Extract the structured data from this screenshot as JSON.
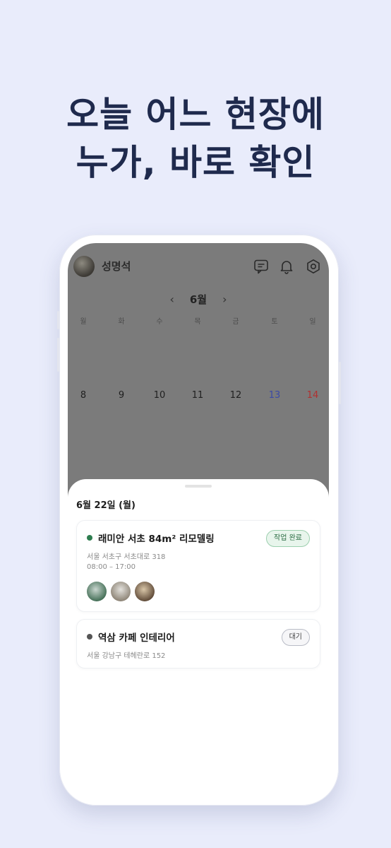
{
  "headline": {
    "line1": "오늘 어느 현장에",
    "line2": "누가, 바로 확인"
  },
  "header": {
    "user_name": "성명석",
    "icons": [
      "chat-icon",
      "bell-icon",
      "settings-icon"
    ]
  },
  "calendar": {
    "month": "6월",
    "prev": "‹",
    "next": "›",
    "weekdays": [
      "월",
      "화",
      "수",
      "목",
      "금",
      "토",
      "일"
    ],
    "dates": [
      "8",
      "9",
      "10",
      "11",
      "12",
      "13",
      "14"
    ]
  },
  "sheet": {
    "date_title": "6월 22일 (월)",
    "jobs": [
      {
        "title": "래미안 서초 84m² 리모델링",
        "address": "서울 서초구 서초대로 318",
        "time": "08:00 – 17:00",
        "status": "작업 완료",
        "dot_color": "#2e7d4f"
      },
      {
        "title": "역삼 카페 인테리어",
        "address": "서울 강남구 테헤란로 152",
        "status": "대기",
        "dot_color": "#555555"
      }
    ]
  },
  "colors": {
    "background": "#e9ecfb",
    "headline": "#1f2a4d",
    "saturday": "#3b4aa6",
    "sunday": "#b03030"
  }
}
